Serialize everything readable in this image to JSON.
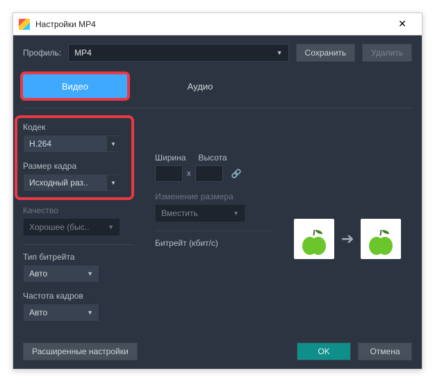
{
  "window": {
    "title": "Настройки MP4"
  },
  "profile": {
    "label": "Профиль:",
    "value": "MP4"
  },
  "buttons": {
    "save": "Сохранить",
    "delete": "Удалить",
    "advanced": "Расширенные настройки",
    "ok": "OK",
    "cancel": "Отмена"
  },
  "tabs": {
    "video": "Видео",
    "audio": "Аудио"
  },
  "video": {
    "codec": {
      "label": "Кодек",
      "value": "H.264"
    },
    "frame_size": {
      "label": "Размер кадра",
      "value": "Исходный раз.."
    },
    "quality": {
      "label": "Качество",
      "value": "Хорошее (быс.."
    },
    "bitrate_type": {
      "label": "Тип битрейта",
      "value": "Авто"
    },
    "fps": {
      "label": "Частота кадров",
      "value": "Авто"
    },
    "width_label": "Ширина",
    "height_label": "Высота",
    "resize_mode": {
      "label": "Изменение размера",
      "value": "Вместить"
    },
    "bitrate": {
      "label": "Битрейт (кбит/с)"
    }
  }
}
